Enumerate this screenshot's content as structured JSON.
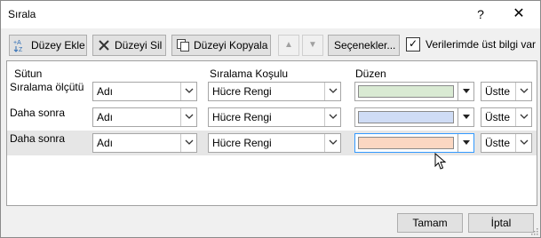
{
  "window": {
    "title": "Sırala",
    "help_glyph": "?",
    "close_glyph": "✕"
  },
  "toolbar": {
    "add_label": "Düzey Ekle",
    "delete_label": "Düzeyi Sil",
    "copy_label": "Düzeyi Kopyala",
    "move_up_glyph": "▲",
    "move_down_glyph": "▼",
    "options_label": "Seçenekler...",
    "headers_checkbox": {
      "checked": true,
      "glyph": "✓",
      "label": "Verilerimde üst bilgi var"
    }
  },
  "grid": {
    "columns": {
      "column": "Sütun",
      "sort_on": "Sıralama Koşulu",
      "order": "Düzen"
    },
    "rows": [
      {
        "label": "Sıralama ölçütü",
        "column": "Adı",
        "sort_on": "Hücre Rengi",
        "color": "#d9ead3",
        "position": "Üstte"
      },
      {
        "label": "Daha sonra",
        "column": "Adı",
        "sort_on": "Hücre Rengi",
        "color": "#cfdcf5",
        "position": "Üstte"
      },
      {
        "label": "Daha sonra",
        "column": "Adı",
        "sort_on": "Hücre Rengi",
        "color": "#fbd7c2",
        "position": "Üstte",
        "selected": true
      }
    ]
  },
  "footer": {
    "ok_label": "Tamam",
    "cancel_label": "İptal"
  },
  "colors": {
    "focus_border": "#3399ff",
    "selected_row": "#e6e6e6"
  }
}
